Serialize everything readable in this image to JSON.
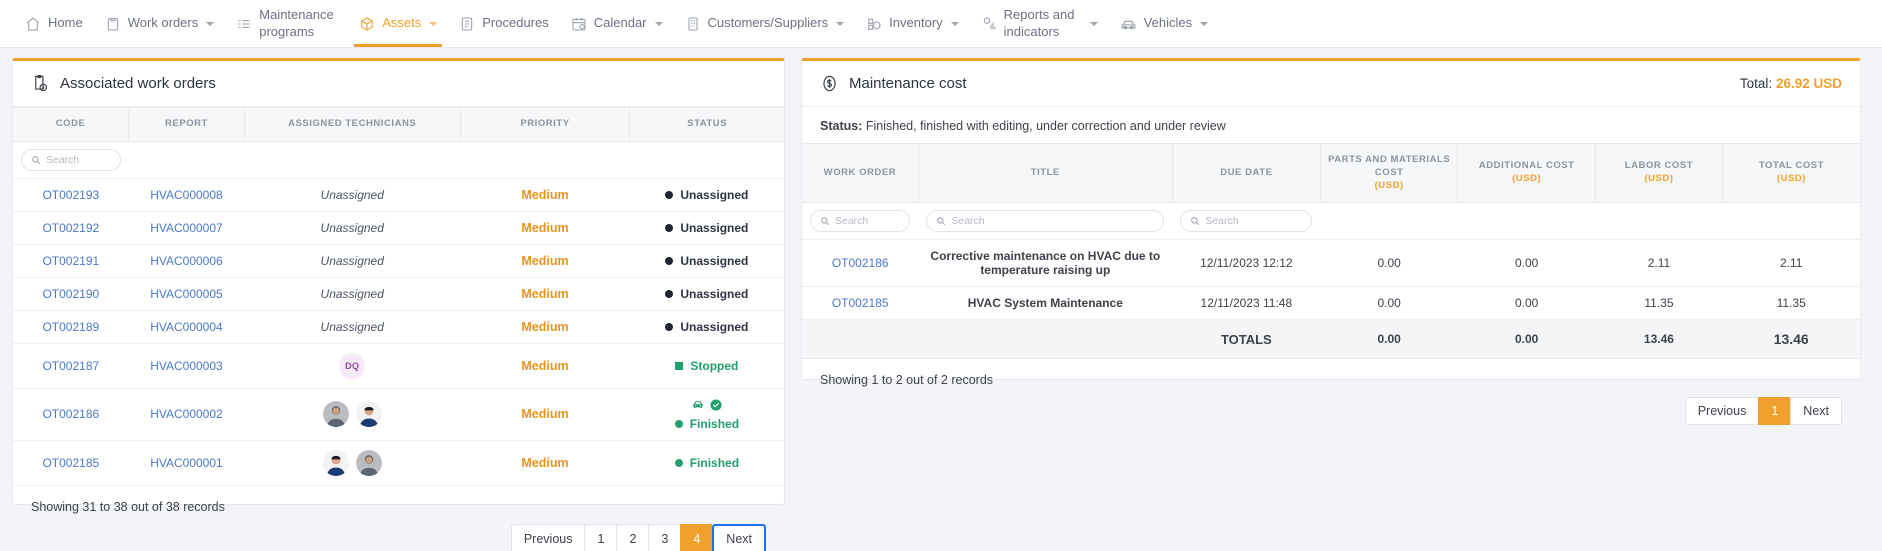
{
  "nav": {
    "items": [
      {
        "label": "Home",
        "icon": "home-icon",
        "caret": false,
        "active": false
      },
      {
        "label": "Work orders",
        "icon": "clipboard-icon",
        "caret": true,
        "active": false
      },
      {
        "label": "Maintenance programs",
        "icon": "checklist-icon",
        "caret": false,
        "active": false,
        "two_line": true
      },
      {
        "label": "Assets",
        "icon": "cube-icon",
        "caret": true,
        "active": true
      },
      {
        "label": "Procedures",
        "icon": "document-list-icon",
        "caret": false,
        "active": false
      },
      {
        "label": "Calendar",
        "icon": "calendar-clock-icon",
        "caret": true,
        "active": false
      },
      {
        "label": "Customers/Suppliers",
        "icon": "building-icon",
        "caret": true,
        "active": false
      },
      {
        "label": "Inventory",
        "icon": "inventory-icon",
        "caret": true,
        "active": false
      },
      {
        "label": "Reports and indicators",
        "icon": "chart-icon",
        "caret": true,
        "active": false,
        "two_line": true
      },
      {
        "label": "Vehicles",
        "icon": "car-icon",
        "caret": true,
        "active": false
      }
    ]
  },
  "left_panel": {
    "title": "Associated work orders",
    "title_icon": "clipboard-clock-icon",
    "columns": [
      "CODE",
      "REPORT",
      "ASSIGNED TECHNICIANS",
      "PRIORITY",
      "STATUS"
    ],
    "search_placeholder": "Search",
    "rows": [
      {
        "code": "OT002193",
        "report": "HVAC000008",
        "technicians_text": "Unassigned",
        "technicians_type": "text",
        "priority": "Medium",
        "status": "Unassigned",
        "status_type": "unassigned"
      },
      {
        "code": "OT002192",
        "report": "HVAC000007",
        "technicians_text": "Unassigned",
        "technicians_type": "text",
        "priority": "Medium",
        "status": "Unassigned",
        "status_type": "unassigned"
      },
      {
        "code": "OT002191",
        "report": "HVAC000006",
        "technicians_text": "Unassigned",
        "technicians_type": "text",
        "priority": "Medium",
        "status": "Unassigned",
        "status_type": "unassigned"
      },
      {
        "code": "OT002190",
        "report": "HVAC000005",
        "technicians_text": "Unassigned",
        "technicians_type": "text",
        "priority": "Medium",
        "status": "Unassigned",
        "status_type": "unassigned"
      },
      {
        "code": "OT002189",
        "report": "HVAC000004",
        "technicians_text": "Unassigned",
        "technicians_type": "text",
        "priority": "Medium",
        "status": "Unassigned",
        "status_type": "unassigned"
      },
      {
        "code": "OT002187",
        "report": "HVAC000003",
        "technicians_text": "DQ",
        "technicians_type": "initials",
        "priority": "Medium",
        "status": "Stopped",
        "status_type": "stopped"
      },
      {
        "code": "OT002186",
        "report": "HVAC000002",
        "technicians_text": "",
        "technicians_type": "avatars",
        "priority": "Medium",
        "status": "Finished",
        "status_type": "finished-icons"
      },
      {
        "code": "OT002185",
        "report": "HVAC000001",
        "technicians_text": "",
        "technicians_type": "avatars",
        "priority": "Medium",
        "status": "Finished",
        "status_type": "finished"
      }
    ],
    "records_text": "Showing 31 to 38 out of 38 records",
    "pagination": {
      "previous_label": "Previous",
      "pages": [
        "1",
        "2",
        "3",
        "4"
      ],
      "active_page": "4",
      "next_label": "Next"
    }
  },
  "right_panel": {
    "title": "Maintenance cost",
    "title_icon": "dollar-circle-icon",
    "total_label": "Total:",
    "total_value": "26.92 USD",
    "status_label": "Status:",
    "status_value": "Finished, finished with editing, under correction and under review",
    "columns": [
      {
        "label": "WORK ORDER",
        "unit": ""
      },
      {
        "label": "TITLE",
        "unit": ""
      },
      {
        "label": "DUE DATE",
        "unit": ""
      },
      {
        "label": "PARTS AND MATERIALS COST",
        "unit": "(USD)"
      },
      {
        "label": "ADDITIONAL COST",
        "unit": "(USD)"
      },
      {
        "label": "LABOR COST",
        "unit": "(USD)"
      },
      {
        "label": "TOTAL COST",
        "unit": "(USD)"
      }
    ],
    "search_placeholder": "Search",
    "rows": [
      {
        "work_order": "OT002186",
        "title": "Corrective maintenance on HVAC due to temperature raising up",
        "due_date": "12/11/2023 12:12",
        "parts_cost": "0.00",
        "additional_cost": "0.00",
        "labor_cost": "2.11",
        "total_cost": "2.11"
      },
      {
        "work_order": "OT002185",
        "title": "HVAC System Maintenance",
        "due_date": "12/11/2023 11:48",
        "parts_cost": "0.00",
        "additional_cost": "0.00",
        "labor_cost": "11.35",
        "total_cost": "11.35"
      }
    ],
    "totals": {
      "label": "TOTALS",
      "parts_cost": "0.00",
      "additional_cost": "0.00",
      "labor_cost": "13.46",
      "total_cost": "13.46"
    },
    "records_text": "Showing 1 to 2 out of 2 records",
    "pagination": {
      "previous_label": "Previous",
      "pages": [
        "1"
      ],
      "active_page": "1",
      "next_label": "Next"
    }
  },
  "colors": {
    "accent": "#f0a02c",
    "link": "#4a79c7",
    "success": "#22a06b",
    "priority": "#e8941f"
  }
}
